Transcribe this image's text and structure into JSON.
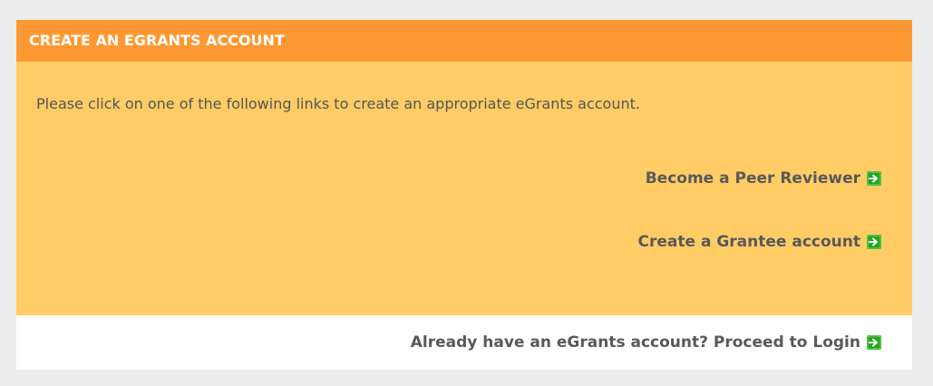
{
  "panel": {
    "header_title": "CREATE AN EGRANTS ACCOUNT",
    "intro_text": "Please click on one of the following links to create an appropriate eGrants account.",
    "links": [
      {
        "label": "Become a Peer Reviewer",
        "icon": "green-arrow-icon"
      },
      {
        "label": "Create a Grantee account",
        "icon": "green-arrow-icon"
      }
    ],
    "footer_link": {
      "label": "Already have an eGrants account? Proceed to Login",
      "icon": "green-arrow-icon"
    }
  },
  "colors": {
    "page_background": "#ededed",
    "header_background": "#fd9933",
    "body_background": "#ffcc66",
    "footer_background": "#ffffff",
    "link_text": "#595959",
    "icon_green": "#22a61e"
  }
}
